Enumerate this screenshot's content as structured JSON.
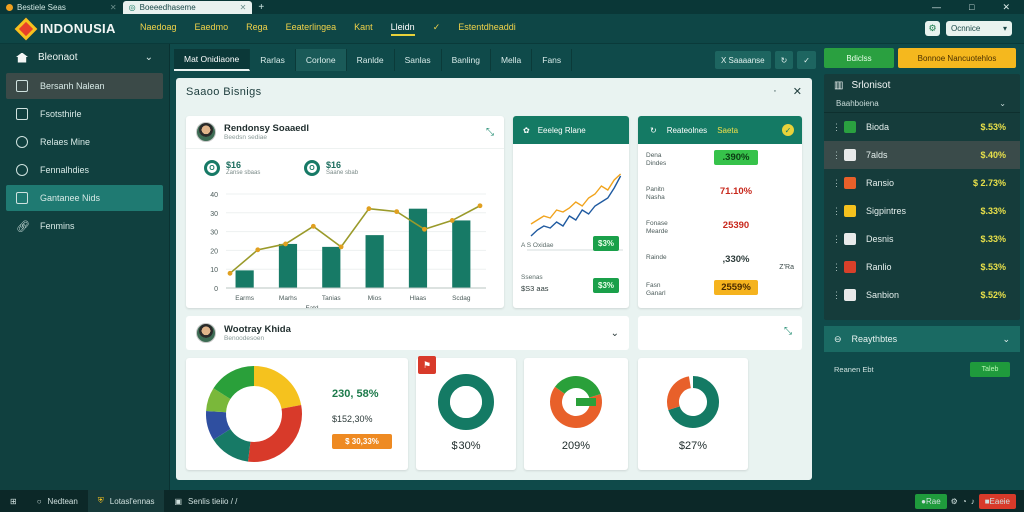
{
  "browser": {
    "tabs": [
      {
        "label": "Bestiele Seas",
        "active": false
      },
      {
        "label": "Boeeedhaseme",
        "active": true
      }
    ]
  },
  "brand": {
    "name": "INDONUSIA"
  },
  "nav": {
    "items": [
      "Naedoag",
      "Eaedmo",
      "Rega",
      "Eeaterlingea",
      "Kant",
      "Lleidn",
      "Estentdheaddi"
    ],
    "active_index": 5,
    "language": "Ocnnice"
  },
  "sidebar": {
    "header": "Bleonaot",
    "items": [
      {
        "label": "Bersanh Nalean",
        "state": "selected"
      },
      {
        "label": "Fsotsthirle",
        "state": ""
      },
      {
        "label": "Relaes Mine",
        "state": ""
      },
      {
        "label": "Fennalhdies",
        "state": ""
      },
      {
        "label": "Gantanee Nids",
        "state": "active"
      },
      {
        "label": "Fenmins",
        "state": ""
      }
    ]
  },
  "subtabs": {
    "items": [
      "Mat Onidiaone",
      "Rarlas",
      "Corlone",
      "Ranlde",
      "Sanlas",
      "Banling",
      "Mella",
      "Fans"
    ],
    "active_index": 0,
    "action_label": "X Saaaanse"
  },
  "panel": {
    "title": "Saaoo Bisnigs"
  },
  "chart_card": {
    "title": "Rendonsy Soaaedl",
    "subtitle": "Beedsn sediae",
    "stats": [
      {
        "value": "$16",
        "label": "Zanse sbaas"
      },
      {
        "value": "$16",
        "label": "Saane sbab"
      }
    ],
    "xlabel": "Fatd"
  },
  "chart_data": {
    "type": "bar",
    "categories": [
      "Earms",
      "Marhs",
      "Tanias",
      "Mios",
      "Hlaas",
      "Scdag"
    ],
    "values": [
      6,
      15,
      14,
      18,
      27,
      23
    ],
    "line": [
      5,
      13,
      15,
      21,
      14,
      27,
      26,
      20,
      23,
      28
    ],
    "yticks": [
      "0",
      "10",
      "20",
      "30",
      "30",
      "40"
    ],
    "ylim": [
      0,
      32
    ]
  },
  "line_card": {
    "header": "Eeeleg Rlane",
    "rows": [
      {
        "label": "A S Oxidae",
        "value": "$3%"
      },
      {
        "label": "Ssenas",
        "sub": "$S3 aas",
        "value": "$3%"
      }
    ],
    "colors": {
      "up": "#f1a31c",
      "down": "#1f5aa0"
    }
  },
  "rev_card": {
    "header": "Reateolnes",
    "badge": "Saeta",
    "rows": [
      {
        "label": "Dena\nDindes",
        "value": ".390%",
        "style": "lgreen"
      },
      {
        "label": "Panitn\nNasha",
        "value": "71.10%",
        "style": "red"
      },
      {
        "label": "Fonase\nMearde",
        "value": "25390",
        "style": "red"
      },
      {
        "label": "Rainde",
        "value": ",330%",
        "style": "plain"
      },
      {
        "label": "Fasn\nGanarl",
        "value": "2559%",
        "style": "orange"
      }
    ],
    "side": "Z’Ra"
  },
  "bottom": {
    "title": "Wootray Khida",
    "subtitle": "Benoodesoen",
    "main_donut": {
      "values": [
        "230, 58%",
        "$152,30%",
        "$ 30,33%"
      ],
      "colors": [
        "#2aa03a",
        "#f5c21e",
        "#d83a2a",
        "#177a66",
        "#2f4fa0",
        "#7ab83a"
      ]
    },
    "donuts": [
      {
        "label": "$ 30%",
        "color": "#147a64"
      },
      {
        "label": "209%",
        "color": "#2aa03a"
      },
      {
        "label": "$27%",
        "color": "#147a64"
      }
    ]
  },
  "right": {
    "buttons": [
      "Bdiclss",
      "Bonnoe Nancuotehlos"
    ],
    "panel_title": "Srlonisot",
    "sub_label": "Baahboiena",
    "rows": [
      {
        "label": "Bioda",
        "value": "$.53%",
        "color": "#2aa040",
        "highlight": false
      },
      {
        "label": "7alds",
        "value": "$.40%",
        "color": "#e8eaea",
        "highlight": true
      },
      {
        "label": "Ransio",
        "value": "$ 2.73%",
        "color": "#e8602a",
        "highlight": false
      },
      {
        "label": "Sigpintres",
        "value": "$.33%",
        "color": "#f5c21e",
        "highlight": false
      },
      {
        "label": "Desnis",
        "value": "$.33%",
        "color": "#e8eaea",
        "highlight": false
      },
      {
        "label": "Ranlio",
        "value": "$.53%",
        "color": "#d8402a",
        "highlight": false
      },
      {
        "label": "Sanbion",
        "value": "$.52%",
        "color": "#e8eaea",
        "highlight": false
      }
    ],
    "panel2_title": "Reaythbtes",
    "row3_label": "Reanen Ebt",
    "row3_pill": "Taleb"
  },
  "taskbar": {
    "items": [
      "Nedtean",
      "Lotasl'ennas",
      "Senlis tieiio / /"
    ],
    "right": [
      "Rae",
      "Eaeie"
    ]
  }
}
